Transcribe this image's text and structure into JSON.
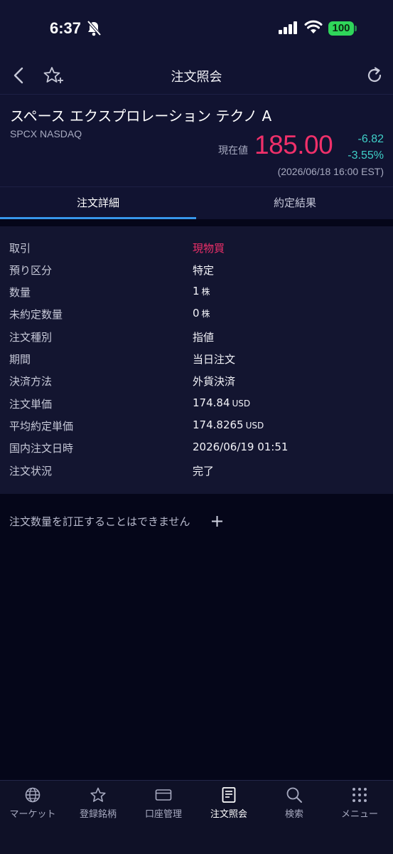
{
  "status_bar": {
    "time": "6:37",
    "battery": "100"
  },
  "nav": {
    "title": "注文照会"
  },
  "stock": {
    "name": "スペース エクスプロレーション テクノ A",
    "ticker": "SPCX NASDAQ",
    "price_label": "現在値",
    "price": "185.00",
    "change_abs": "-6.82",
    "change_pct": "-3.55%",
    "date": "(2026/06/18 16:00 EST)"
  },
  "tabs": [
    {
      "label": "注文詳細",
      "active": true
    },
    {
      "label": "約定結果",
      "active": false
    }
  ],
  "details": [
    {
      "label": "取引",
      "value": "現物買",
      "unit": ""
    },
    {
      "label": "預り区分",
      "value": "特定",
      "unit": ""
    },
    {
      "label": "数量",
      "value": "1",
      "unit": "株"
    },
    {
      "label": "未約定数量",
      "value": "0",
      "unit": "株"
    },
    {
      "label": "注文種別",
      "value": "指値",
      "unit": ""
    },
    {
      "label": "期間",
      "value": "当日注文",
      "unit": ""
    },
    {
      "label": "決済方法",
      "value": "外貨決済",
      "unit": ""
    },
    {
      "label": "注文単価",
      "value": "174.84",
      "unit": "USD"
    },
    {
      "label": "平均約定単価",
      "value": "174.8265",
      "unit": "USD"
    },
    {
      "label": "国内注文日時",
      "value": "2026/06/19 01:51",
      "unit": ""
    },
    {
      "label": "注文状況",
      "value": "完了",
      "unit": ""
    }
  ],
  "note": "注文数量を訂正することはできません",
  "bottom_tabs": [
    {
      "label": "マーケット",
      "icon": "globe-icon"
    },
    {
      "label": "登録銘柄",
      "icon": "star-icon"
    },
    {
      "label": "口座管理",
      "icon": "card-icon"
    },
    {
      "label": "注文照会",
      "icon": "document-icon",
      "active": true
    },
    {
      "label": "検索",
      "icon": "search-icon"
    },
    {
      "label": "メニュー",
      "icon": "grid-icon"
    }
  ],
  "colors": {
    "accent": "#3796ea",
    "buy": "#f0306a",
    "change": "#3fd0c8",
    "background": "#050619"
  }
}
